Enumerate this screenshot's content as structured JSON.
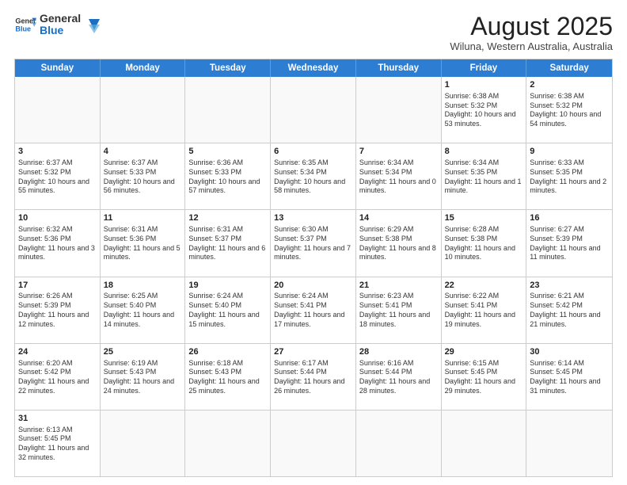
{
  "header": {
    "logo_line1": "General",
    "logo_line2": "Blue",
    "title": "August 2025",
    "subtitle": "Wiluna, Western Australia, Australia"
  },
  "days_of_week": [
    "Sunday",
    "Monday",
    "Tuesday",
    "Wednesday",
    "Thursday",
    "Friday",
    "Saturday"
  ],
  "weeks": [
    [
      {
        "day": "",
        "info": ""
      },
      {
        "day": "",
        "info": ""
      },
      {
        "day": "",
        "info": ""
      },
      {
        "day": "",
        "info": ""
      },
      {
        "day": "",
        "info": ""
      },
      {
        "day": "1",
        "info": "Sunrise: 6:38 AM\nSunset: 5:32 PM\nDaylight: 10 hours and 53 minutes."
      },
      {
        "day": "2",
        "info": "Sunrise: 6:38 AM\nSunset: 5:32 PM\nDaylight: 10 hours and 54 minutes."
      }
    ],
    [
      {
        "day": "3",
        "info": "Sunrise: 6:37 AM\nSunset: 5:32 PM\nDaylight: 10 hours and 55 minutes."
      },
      {
        "day": "4",
        "info": "Sunrise: 6:37 AM\nSunset: 5:33 PM\nDaylight: 10 hours and 56 minutes."
      },
      {
        "day": "5",
        "info": "Sunrise: 6:36 AM\nSunset: 5:33 PM\nDaylight: 10 hours and 57 minutes."
      },
      {
        "day": "6",
        "info": "Sunrise: 6:35 AM\nSunset: 5:34 PM\nDaylight: 10 hours and 58 minutes."
      },
      {
        "day": "7",
        "info": "Sunrise: 6:34 AM\nSunset: 5:34 PM\nDaylight: 11 hours and 0 minutes."
      },
      {
        "day": "8",
        "info": "Sunrise: 6:34 AM\nSunset: 5:35 PM\nDaylight: 11 hours and 1 minute."
      },
      {
        "day": "9",
        "info": "Sunrise: 6:33 AM\nSunset: 5:35 PM\nDaylight: 11 hours and 2 minutes."
      }
    ],
    [
      {
        "day": "10",
        "info": "Sunrise: 6:32 AM\nSunset: 5:36 PM\nDaylight: 11 hours and 3 minutes."
      },
      {
        "day": "11",
        "info": "Sunrise: 6:31 AM\nSunset: 5:36 PM\nDaylight: 11 hours and 5 minutes."
      },
      {
        "day": "12",
        "info": "Sunrise: 6:31 AM\nSunset: 5:37 PM\nDaylight: 11 hours and 6 minutes."
      },
      {
        "day": "13",
        "info": "Sunrise: 6:30 AM\nSunset: 5:37 PM\nDaylight: 11 hours and 7 minutes."
      },
      {
        "day": "14",
        "info": "Sunrise: 6:29 AM\nSunset: 5:38 PM\nDaylight: 11 hours and 8 minutes."
      },
      {
        "day": "15",
        "info": "Sunrise: 6:28 AM\nSunset: 5:38 PM\nDaylight: 11 hours and 10 minutes."
      },
      {
        "day": "16",
        "info": "Sunrise: 6:27 AM\nSunset: 5:39 PM\nDaylight: 11 hours and 11 minutes."
      }
    ],
    [
      {
        "day": "17",
        "info": "Sunrise: 6:26 AM\nSunset: 5:39 PM\nDaylight: 11 hours and 12 minutes."
      },
      {
        "day": "18",
        "info": "Sunrise: 6:25 AM\nSunset: 5:40 PM\nDaylight: 11 hours and 14 minutes."
      },
      {
        "day": "19",
        "info": "Sunrise: 6:24 AM\nSunset: 5:40 PM\nDaylight: 11 hours and 15 minutes."
      },
      {
        "day": "20",
        "info": "Sunrise: 6:24 AM\nSunset: 5:41 PM\nDaylight: 11 hours and 17 minutes."
      },
      {
        "day": "21",
        "info": "Sunrise: 6:23 AM\nSunset: 5:41 PM\nDaylight: 11 hours and 18 minutes."
      },
      {
        "day": "22",
        "info": "Sunrise: 6:22 AM\nSunset: 5:41 PM\nDaylight: 11 hours and 19 minutes."
      },
      {
        "day": "23",
        "info": "Sunrise: 6:21 AM\nSunset: 5:42 PM\nDaylight: 11 hours and 21 minutes."
      }
    ],
    [
      {
        "day": "24",
        "info": "Sunrise: 6:20 AM\nSunset: 5:42 PM\nDaylight: 11 hours and 22 minutes."
      },
      {
        "day": "25",
        "info": "Sunrise: 6:19 AM\nSunset: 5:43 PM\nDaylight: 11 hours and 24 minutes."
      },
      {
        "day": "26",
        "info": "Sunrise: 6:18 AM\nSunset: 5:43 PM\nDaylight: 11 hours and 25 minutes."
      },
      {
        "day": "27",
        "info": "Sunrise: 6:17 AM\nSunset: 5:44 PM\nDaylight: 11 hours and 26 minutes."
      },
      {
        "day": "28",
        "info": "Sunrise: 6:16 AM\nSunset: 5:44 PM\nDaylight: 11 hours and 28 minutes."
      },
      {
        "day": "29",
        "info": "Sunrise: 6:15 AM\nSunset: 5:45 PM\nDaylight: 11 hours and 29 minutes."
      },
      {
        "day": "30",
        "info": "Sunrise: 6:14 AM\nSunset: 5:45 PM\nDaylight: 11 hours and 31 minutes."
      }
    ],
    [
      {
        "day": "31",
        "info": "Sunrise: 6:13 AM\nSunset: 5:45 PM\nDaylight: 11 hours and 32 minutes."
      },
      {
        "day": "",
        "info": ""
      },
      {
        "day": "",
        "info": ""
      },
      {
        "day": "",
        "info": ""
      },
      {
        "day": "",
        "info": ""
      },
      {
        "day": "",
        "info": ""
      },
      {
        "day": "",
        "info": ""
      }
    ]
  ]
}
